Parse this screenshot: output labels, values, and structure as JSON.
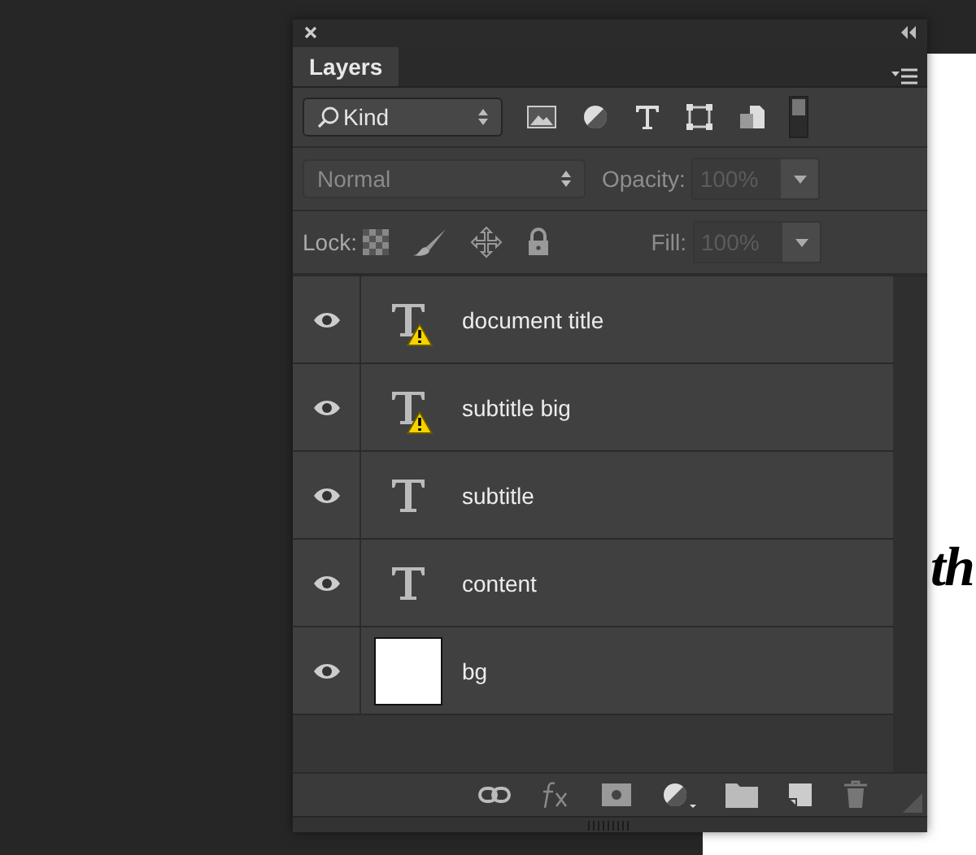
{
  "panel": {
    "tabs": [
      {
        "label": "Layers",
        "selected": true
      }
    ]
  },
  "filter": {
    "value": "Kind"
  },
  "blend": {
    "mode": "Normal",
    "opacity_label": "Opacity:",
    "opacity": "100%",
    "disabled": true
  },
  "lock": {
    "label": "Lock:",
    "fill_label": "Fill:",
    "fill": "100%",
    "disabled": true
  },
  "layers": [
    {
      "name": "document title",
      "kind": "text",
      "warning": true,
      "visible": true
    },
    {
      "name": "subtitle big",
      "kind": "text",
      "warning": true,
      "visible": true
    },
    {
      "name": "subtitle",
      "kind": "text",
      "warning": false,
      "visible": true
    },
    {
      "name": "content",
      "kind": "text",
      "warning": false,
      "visible": true
    },
    {
      "name": "bg",
      "kind": "fill",
      "warning": false,
      "visible": true
    }
  ],
  "canvas": {
    "text": "th"
  }
}
